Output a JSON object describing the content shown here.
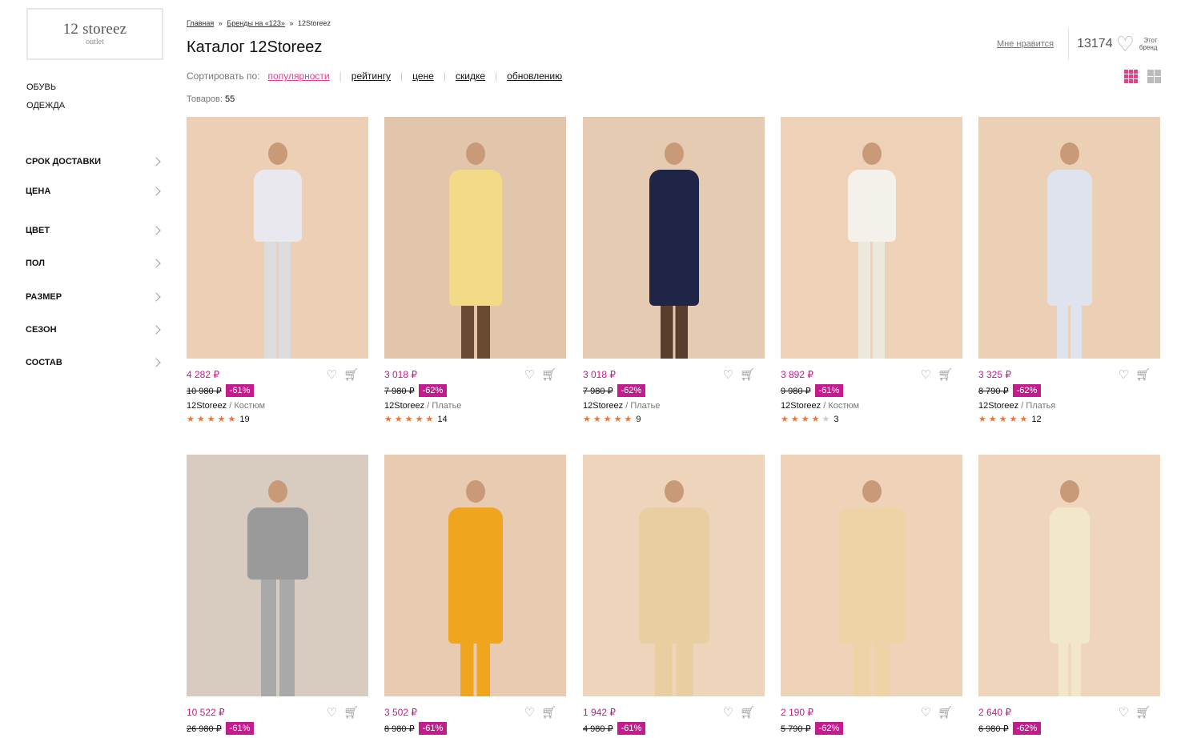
{
  "logo": {
    "name": "12 storeez",
    "sub": "outlet"
  },
  "categories": [
    "ОБУВЬ",
    "ОДЕЖДА"
  ],
  "filters": [
    "СРОК ДОСТАВКИ",
    "ЦЕНА",
    "ЦВЕТ",
    "ПОЛ",
    "РАЗМЕР",
    "СЕЗОН",
    "СОСТАВ"
  ],
  "breadcrumb": {
    "home": "Главная",
    "sep": "»",
    "brands": "Бренды на «123»",
    "current": "12Storeez"
  },
  "title": "Каталог 12Storeez",
  "sort": {
    "label": "Сортировать по:",
    "options": [
      "популярности",
      "рейтингу",
      "цене",
      "скидке",
      "обновлению"
    ],
    "active": "популярности"
  },
  "count": {
    "label": "Товаров:",
    "value": "55"
  },
  "likes": {
    "button": "Мне нравится",
    "count": "13174",
    "brand_line1": "Этот",
    "brand_line2": "бренд"
  },
  "colors": {
    "accent": "#c41c8e",
    "sort_active": "#e0408f",
    "star": "#e8763a"
  },
  "products": [
    {
      "price": "4 282 ₽",
      "old_price": "10 980 ₽",
      "discount": "-61%",
      "brand": "12Storeez",
      "type": "/ Костюм",
      "rating": 5,
      "reviews": "19"
    },
    {
      "price": "3 018 ₽",
      "old_price": "7 980 ₽",
      "discount": "-62%",
      "brand": "12Storeez",
      "type": "/ Платье",
      "rating": 5,
      "reviews": "14"
    },
    {
      "price": "3 018 ₽",
      "old_price": "7 980 ₽",
      "discount": "-62%",
      "brand": "12Storeez",
      "type": "/ Платье",
      "rating": 5,
      "reviews": "9"
    },
    {
      "price": "3 892 ₽",
      "old_price": "9 980 ₽",
      "discount": "-61%",
      "brand": "12Storeez",
      "type": "/ Костюм",
      "rating": 4,
      "reviews": "3"
    },
    {
      "price": "3 325 ₽",
      "old_price": "8 790 ₽",
      "discount": "-62%",
      "brand": "12Storeez",
      "type": "/ Платья",
      "rating": 5,
      "reviews": "12"
    },
    {
      "price": "10 522 ₽",
      "old_price": "26 980 ₽",
      "discount": "-61%"
    },
    {
      "price": "3 502 ₽",
      "old_price": "8 980 ₽",
      "discount": "-61%"
    },
    {
      "price": "1 942 ₽",
      "old_price": "4 980 ₽",
      "discount": "-61%"
    },
    {
      "price": "2 190 ₽",
      "old_price": "5 790 ₽",
      "discount": "-62%"
    },
    {
      "price": "2 640 ₽",
      "old_price": "6 980 ₽",
      "discount": "-62%"
    }
  ]
}
